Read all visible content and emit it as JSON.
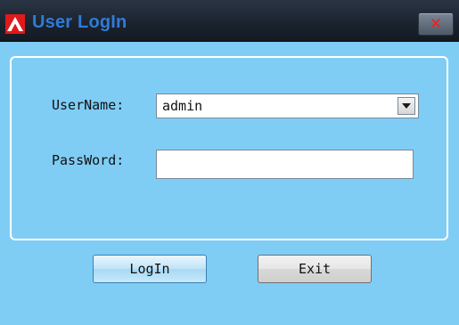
{
  "window": {
    "title": "User LogIn",
    "close_symbol": "✕",
    "icon": "app-logo-icon"
  },
  "form": {
    "username_label": "UserName:",
    "username_value": "admin",
    "password_label": "PassWord:",
    "password_value": ""
  },
  "buttons": {
    "login_label": "LogIn",
    "exit_label": "Exit"
  },
  "colors": {
    "background": "#7fcdf5",
    "titlebar": "#1a222d",
    "title_text": "#2f7bd6",
    "close_x": "#ff1a1a",
    "icon_red": "#e01a1a"
  }
}
